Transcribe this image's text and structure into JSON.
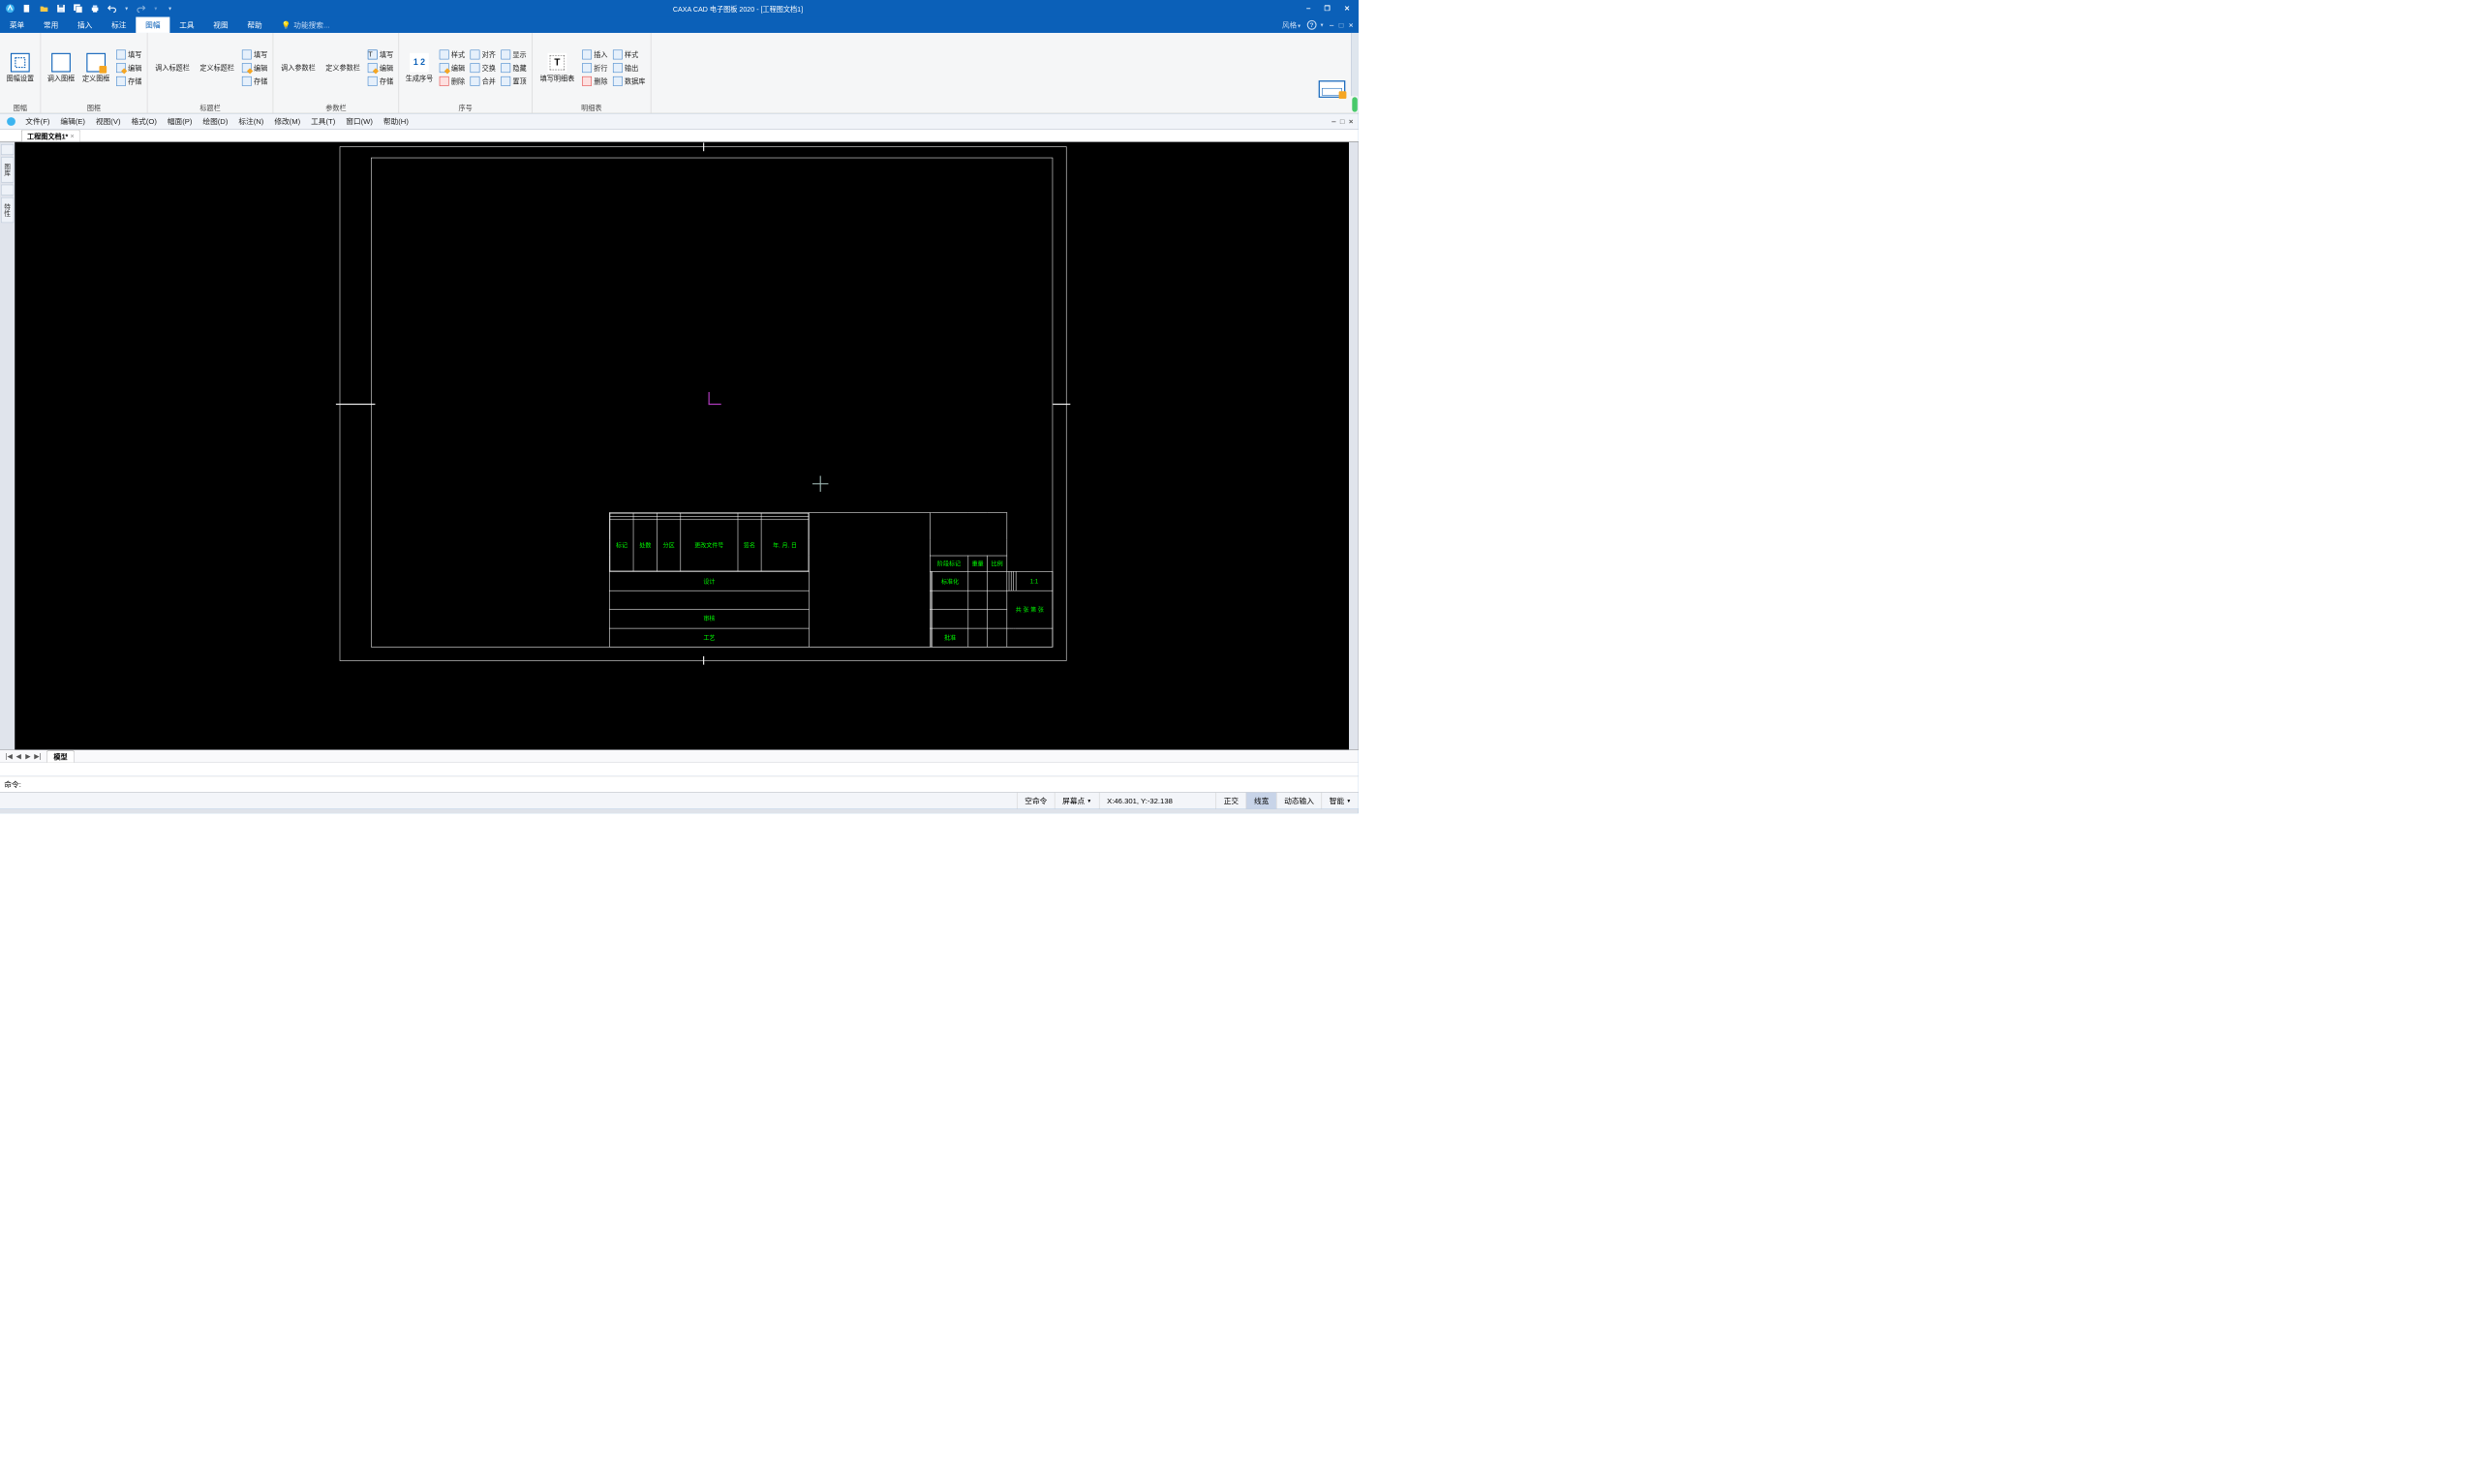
{
  "titlebar": {
    "app_title": "CAXA CAD 电子图板 2020 - [工程图文档1]",
    "qat": [
      "app-icon",
      "new-icon",
      "open-icon",
      "save-icon",
      "saveall-icon",
      "print-icon",
      "undo-icon",
      "redo-icon",
      "dropdown-icon"
    ]
  },
  "ribbon_tabs": [
    "菜单",
    "常用",
    "插入",
    "标注",
    "图幅",
    "工具",
    "视图",
    "帮助"
  ],
  "ribbon_active_index": 4,
  "ribbon_search_placeholder": "功能搜索...",
  "ribbon_right": {
    "style_label": "风格",
    "min": "‒",
    "max": "□",
    "close": "×"
  },
  "ribbon_groups": {
    "g1": {
      "title": "图幅",
      "btn": "图幅设置"
    },
    "g2": {
      "title": "图框",
      "btns": [
        "调入图框",
        "定义图框"
      ],
      "small": [
        "填写",
        "编辑",
        "存储"
      ]
    },
    "g3": {
      "title": "标题栏",
      "btns": [
        "调入标题栏",
        "定义标题栏"
      ],
      "small": [
        "填写",
        "编辑",
        "存储"
      ]
    },
    "g4": {
      "title": "参数栏",
      "btns": [
        "调入参数栏",
        "定义参数栏"
      ],
      "small": [
        "填写",
        "编辑",
        "存储"
      ]
    },
    "g5": {
      "title": "序号",
      "btn": "生成序号",
      "col1": [
        "样式",
        "编辑",
        "删除"
      ],
      "col2": [
        "对齐",
        "交换",
        "合并"
      ],
      "col3": [
        "显示",
        "隐藏",
        "置顶"
      ]
    },
    "g6": {
      "title": "明细表",
      "btn": "填写明细表",
      "col1": [
        "插入",
        "折行",
        "删除"
      ],
      "col2": [
        "样式",
        "输出",
        "数据库"
      ]
    }
  },
  "classic_menu": [
    "文件(F)",
    "编辑(E)",
    "视图(V)",
    "格式(O)",
    "幅面(P)",
    "绘图(D)",
    "标注(N)",
    "修改(M)",
    "工具(T)",
    "窗口(W)",
    "帮助(H)"
  ],
  "classic_right": {
    "min": "‒",
    "max": "□",
    "close": "×"
  },
  "doc_tab": {
    "label": "工程图文档1*",
    "close": "×"
  },
  "left_palette": [
    "图库",
    "特性"
  ],
  "titleblock_labels": {
    "row1": [
      "标记",
      "处数",
      "分区",
      "更改文件号",
      "签名",
      "年. 月. 日"
    ],
    "design": "设计",
    "std": "标准化",
    "check": "审核",
    "tech": "工艺",
    "approve": "批准",
    "stage": "阶段标记",
    "weight": "重量",
    "scale": "比例",
    "scale_val": "1:1",
    "total": "共        张     第        张"
  },
  "bottom_nav": {
    "first": "|◀",
    "prev": "◀",
    "next": "▶",
    "last": "▶|",
    "model": "模型"
  },
  "cmd": {
    "label": "命令:"
  },
  "status": {
    "empty_cmd": "空命令",
    "snap": "屏幕点",
    "coord": "X:46.301, Y:-32.138",
    "ortho": "正交",
    "lw": "线宽",
    "dyn": "动态输入",
    "smart": "智能"
  }
}
